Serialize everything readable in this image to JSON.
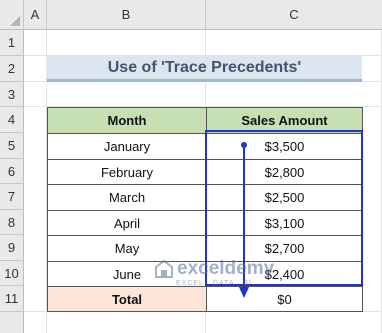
{
  "sheet": {
    "columns": [
      "A",
      "B",
      "C"
    ],
    "rows": [
      "1",
      "2",
      "3",
      "4",
      "5",
      "6",
      "7",
      "8",
      "9",
      "10",
      "11"
    ]
  },
  "title": "Use of 'Trace Precedents'",
  "table": {
    "headers": [
      "Month",
      "Sales Amount"
    ],
    "rows": [
      {
        "month": "January",
        "amount": "$3,500"
      },
      {
        "month": "February",
        "amount": "$2,800"
      },
      {
        "month": "March",
        "amount": "$2,500"
      },
      {
        "month": "April",
        "amount": "$3,100"
      },
      {
        "month": "May",
        "amount": "$2,700"
      },
      {
        "month": "June",
        "amount": "$2,400"
      }
    ],
    "total_label": "Total",
    "total_value": "$0"
  },
  "watermark": {
    "name": "exceldemy",
    "tagline": "EXCEL · DATA · BI"
  },
  "colors": {
    "header_fill": "#c6e0b4",
    "total_fill": "#fce4d6",
    "title_fill": "#dce6f1",
    "trace_arrow": "#2233cc"
  }
}
